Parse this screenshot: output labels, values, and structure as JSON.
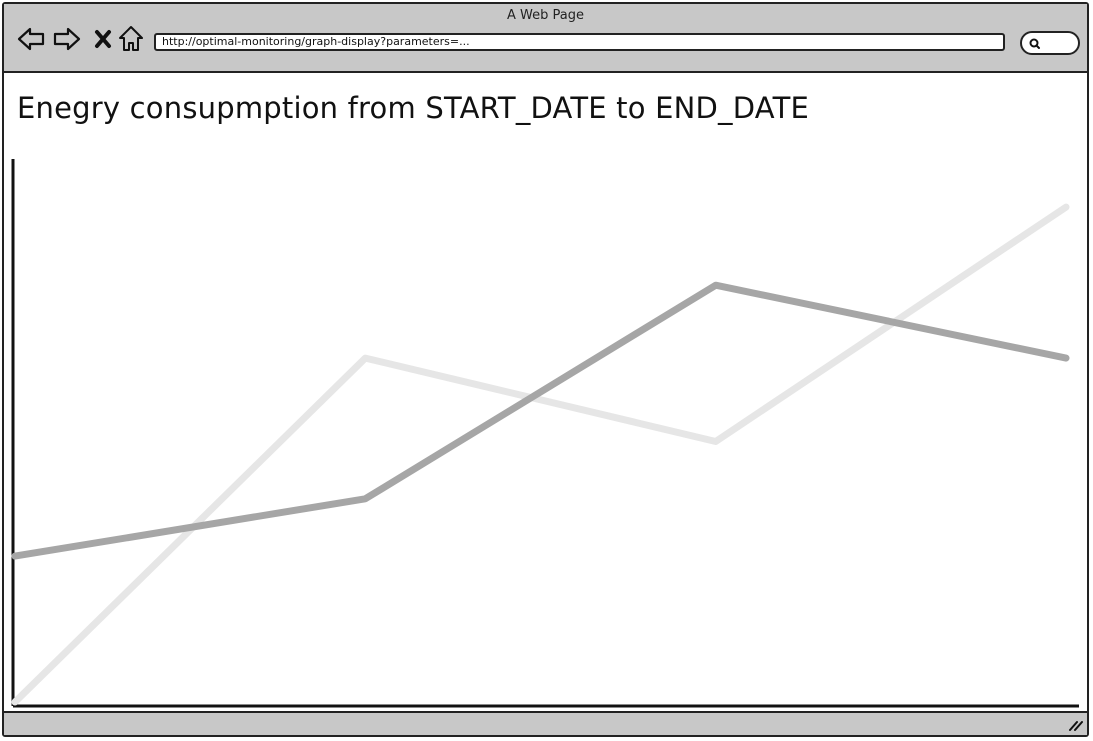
{
  "window": {
    "title": "A Web Page"
  },
  "toolbar": {
    "back_icon": "arrow-left-icon",
    "forward_icon": "arrow-right-icon",
    "stop_icon": "close-icon",
    "home_icon": "home-icon",
    "url": "http://optimal-monitoring/graph-display?parameters=...",
    "search_icon": "search-icon"
  },
  "page": {
    "title": "Enegry consupmption from START_DATE to END_DATE"
  },
  "colors": {
    "chrome": "#c8c8c8",
    "series_dark": "#a6a6a6",
    "series_light": "#e6e6e6",
    "axis": "#111111"
  },
  "chart_data": {
    "type": "line",
    "title": "Enegry consupmption from START_DATE to END_DATE",
    "xlabel": "",
    "ylabel": "",
    "x": [
      0,
      1,
      2,
      3
    ],
    "xlim": [
      0,
      3
    ],
    "ylim": [
      0,
      100
    ],
    "grid": false,
    "legend": "none",
    "series": [
      {
        "color": "#e6e6e6",
        "values": [
          0,
          66,
          50,
          95
        ]
      },
      {
        "color": "#a6a6a6",
        "values": [
          28,
          39,
          80,
          66
        ]
      }
    ]
  }
}
